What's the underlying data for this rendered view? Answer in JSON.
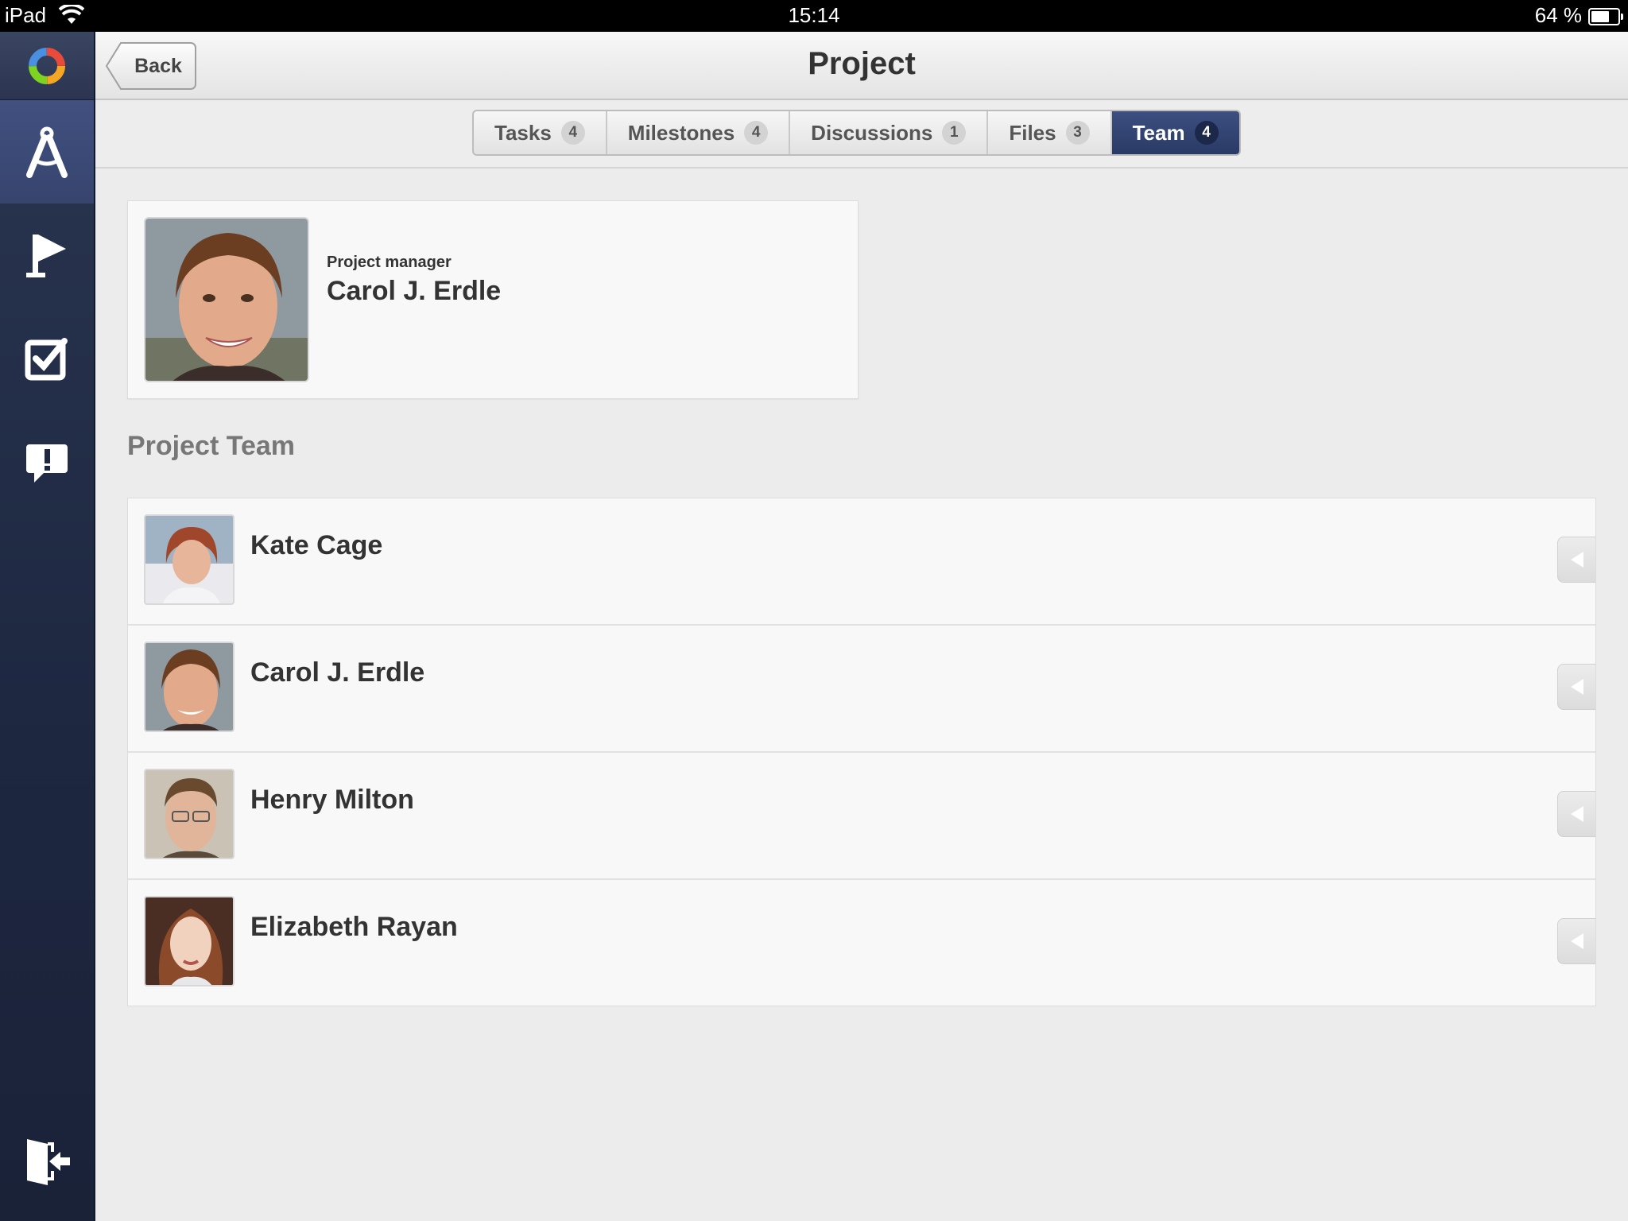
{
  "status_bar": {
    "carrier": "iPad",
    "time": "15:14",
    "battery": "64 %",
    "battery_level": 0.64
  },
  "sidebar": {
    "logo": "app-logo",
    "items": [
      {
        "name": "projects",
        "icon": "compass-icon",
        "active": true
      },
      {
        "name": "milestones",
        "icon": "flag-icon",
        "active": false
      },
      {
        "name": "tasks",
        "icon": "checkbox-icon",
        "active": false
      },
      {
        "name": "discussions",
        "icon": "alert-bubble-icon",
        "active": false
      }
    ],
    "logout_icon": "logout-icon"
  },
  "header": {
    "back_label": "Back",
    "title": "Project"
  },
  "tabs": [
    {
      "label": "Tasks",
      "count": "4",
      "active": false
    },
    {
      "label": "Milestones",
      "count": "4",
      "active": false
    },
    {
      "label": "Discussions",
      "count": "1",
      "active": false
    },
    {
      "label": "Files",
      "count": "3",
      "active": false
    },
    {
      "label": "Team",
      "count": "4",
      "active": true
    }
  ],
  "manager": {
    "role": "Project manager",
    "name": "Carol J. Erdle"
  },
  "team": {
    "title": "Project Team",
    "members": [
      {
        "name": "Kate Cage"
      },
      {
        "name": "Carol J. Erdle"
      },
      {
        "name": "Henry Milton"
      },
      {
        "name": "Elizabeth Rayan"
      }
    ]
  },
  "colors": {
    "sidebar": "#1d2740",
    "active_tab": "#2f3f6c",
    "background": "#ececec"
  }
}
